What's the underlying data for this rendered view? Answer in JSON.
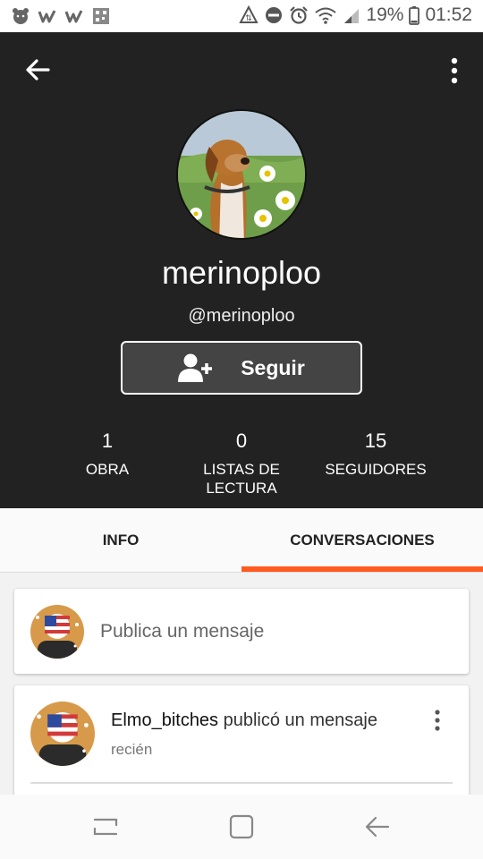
{
  "status_bar": {
    "left_icons": [
      "bear-app-icon",
      "wattpad-icon",
      "wattpad-icon",
      "qr-app-icon"
    ],
    "right_icons": [
      "data-saver-icon",
      "do-not-disturb-icon",
      "alarm-icon",
      "wifi-icon",
      "signal-icon",
      "battery-icon"
    ],
    "battery": "19%",
    "time": "01:52"
  },
  "profile": {
    "display_name": "merinoploo",
    "handle": "@merinoploo",
    "follow_label": "Seguir",
    "stats": [
      {
        "value": "1",
        "label": "OBRA"
      },
      {
        "value": "0",
        "label": "LISTAS DE LECTURA"
      },
      {
        "value": "15",
        "label": "SEGUIDORES"
      }
    ]
  },
  "tabs": [
    {
      "label": "INFO",
      "active": false
    },
    {
      "label": "CONVERSACIONES",
      "active": true
    }
  ],
  "post_box": {
    "placeholder": "Publica un mensaje"
  },
  "messages": [
    {
      "author": "Elmo_bitches",
      "action": " publicó un mensaje",
      "time": "recién"
    }
  ],
  "colors": {
    "header_bg": "#222222",
    "accent": "#ff5a1f",
    "tab_bg": "#fafafa"
  },
  "nav_bar": {
    "icons": [
      "recents-icon",
      "home-icon",
      "back-icon"
    ]
  }
}
